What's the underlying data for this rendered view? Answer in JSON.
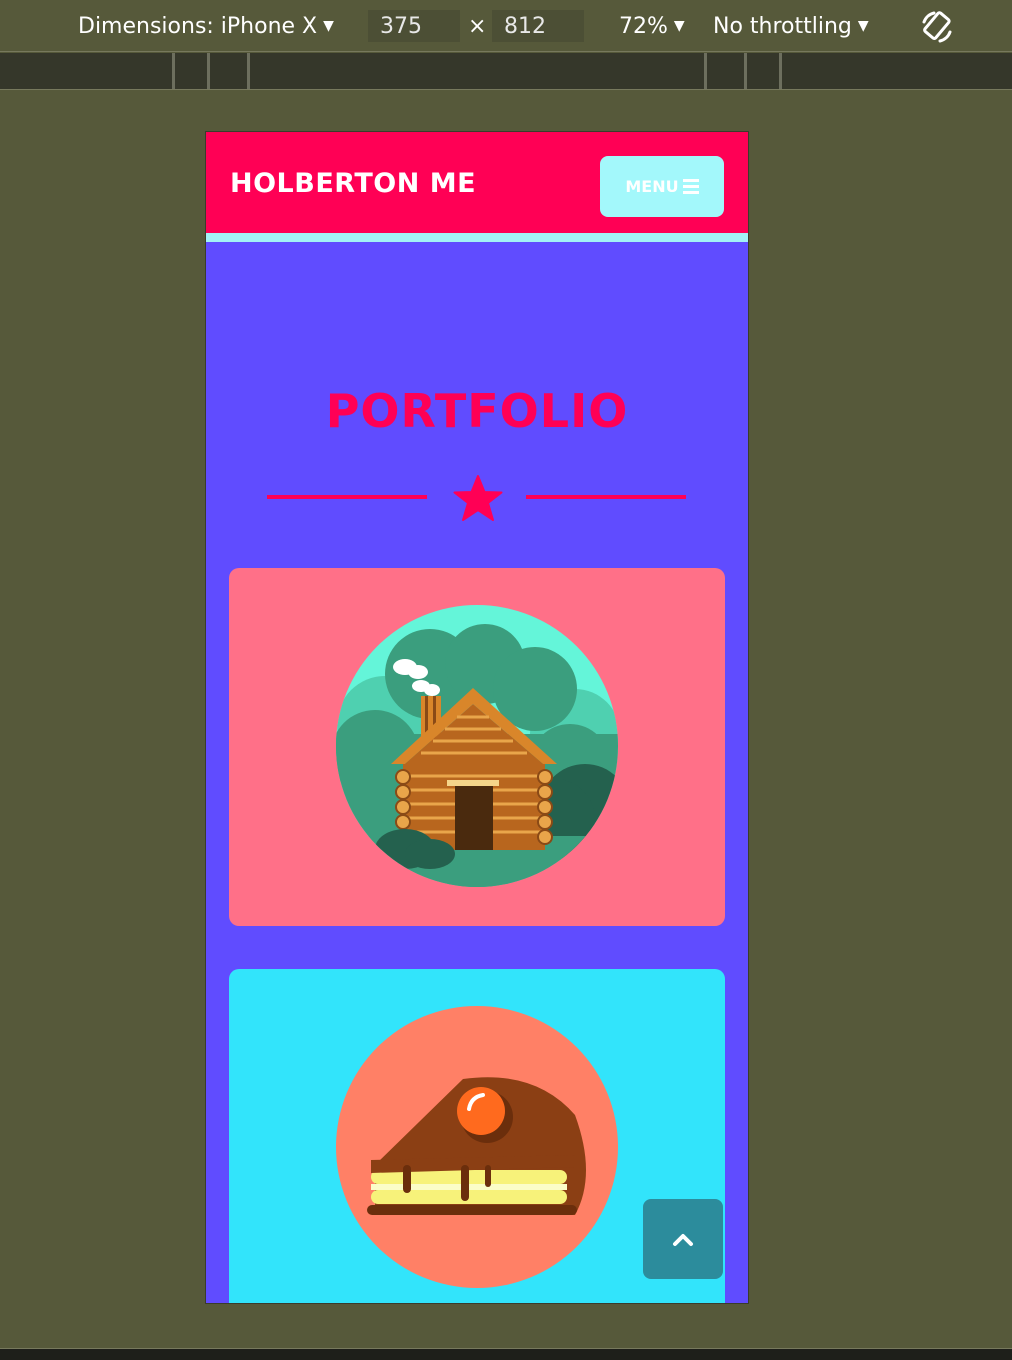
{
  "devtools": {
    "dimensions_label": "Dimensions: iPhone X",
    "width_value": "375",
    "times": "×",
    "height_value": "812",
    "zoom": "72%",
    "throttling": "No throttling",
    "caret": "▼",
    "rotate_icon": "rotate-device-icon"
  },
  "site": {
    "brand": "HOLBERTON ME",
    "menu_label": "MENU",
    "menu_icon": "hamburger-icon",
    "section_title": "PORTFOLIO",
    "divider_icon": "star-icon",
    "cards": [
      {
        "illustration": "log-cabin-icon",
        "background": "#ff7088"
      },
      {
        "illustration": "cake-slice-icon",
        "background": "#32e4fb"
      }
    ],
    "back_to_top_icon": "chevron-up-icon"
  },
  "colors": {
    "primary": "#ff0055",
    "accent": "#a3f2f6",
    "page_bg": "#604cff",
    "scroll_btn": "#2c8c9c"
  }
}
